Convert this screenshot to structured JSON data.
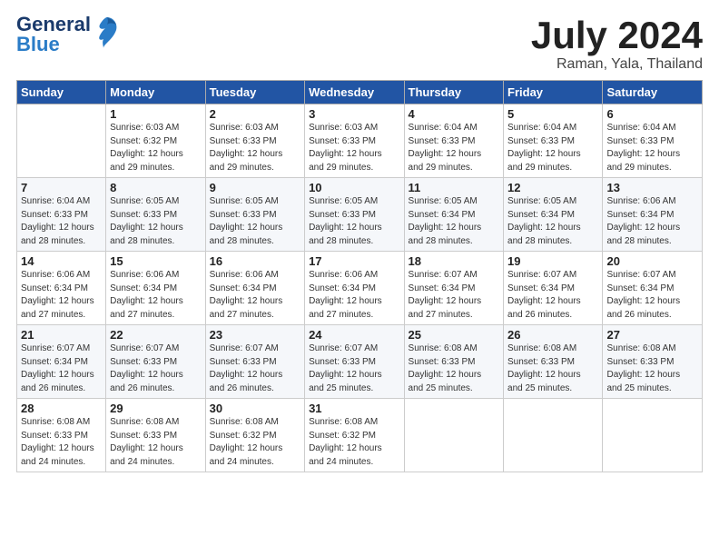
{
  "header": {
    "logo_line1": "General",
    "logo_line2": "Blue",
    "month": "July 2024",
    "location": "Raman, Yala, Thailand"
  },
  "days_of_week": [
    "Sunday",
    "Monday",
    "Tuesday",
    "Wednesday",
    "Thursday",
    "Friday",
    "Saturday"
  ],
  "weeks": [
    [
      {
        "num": "",
        "info": ""
      },
      {
        "num": "1",
        "info": "Sunrise: 6:03 AM\nSunset: 6:32 PM\nDaylight: 12 hours\nand 29 minutes."
      },
      {
        "num": "2",
        "info": "Sunrise: 6:03 AM\nSunset: 6:33 PM\nDaylight: 12 hours\nand 29 minutes."
      },
      {
        "num": "3",
        "info": "Sunrise: 6:03 AM\nSunset: 6:33 PM\nDaylight: 12 hours\nand 29 minutes."
      },
      {
        "num": "4",
        "info": "Sunrise: 6:04 AM\nSunset: 6:33 PM\nDaylight: 12 hours\nand 29 minutes."
      },
      {
        "num": "5",
        "info": "Sunrise: 6:04 AM\nSunset: 6:33 PM\nDaylight: 12 hours\nand 29 minutes."
      },
      {
        "num": "6",
        "info": "Sunrise: 6:04 AM\nSunset: 6:33 PM\nDaylight: 12 hours\nand 29 minutes."
      }
    ],
    [
      {
        "num": "7",
        "info": "Sunrise: 6:04 AM\nSunset: 6:33 PM\nDaylight: 12 hours\nand 28 minutes."
      },
      {
        "num": "8",
        "info": "Sunrise: 6:05 AM\nSunset: 6:33 PM\nDaylight: 12 hours\nand 28 minutes."
      },
      {
        "num": "9",
        "info": "Sunrise: 6:05 AM\nSunset: 6:33 PM\nDaylight: 12 hours\nand 28 minutes."
      },
      {
        "num": "10",
        "info": "Sunrise: 6:05 AM\nSunset: 6:33 PM\nDaylight: 12 hours\nand 28 minutes."
      },
      {
        "num": "11",
        "info": "Sunrise: 6:05 AM\nSunset: 6:34 PM\nDaylight: 12 hours\nand 28 minutes."
      },
      {
        "num": "12",
        "info": "Sunrise: 6:05 AM\nSunset: 6:34 PM\nDaylight: 12 hours\nand 28 minutes."
      },
      {
        "num": "13",
        "info": "Sunrise: 6:06 AM\nSunset: 6:34 PM\nDaylight: 12 hours\nand 28 minutes."
      }
    ],
    [
      {
        "num": "14",
        "info": "Sunrise: 6:06 AM\nSunset: 6:34 PM\nDaylight: 12 hours\nand 27 minutes."
      },
      {
        "num": "15",
        "info": "Sunrise: 6:06 AM\nSunset: 6:34 PM\nDaylight: 12 hours\nand 27 minutes."
      },
      {
        "num": "16",
        "info": "Sunrise: 6:06 AM\nSunset: 6:34 PM\nDaylight: 12 hours\nand 27 minutes."
      },
      {
        "num": "17",
        "info": "Sunrise: 6:06 AM\nSunset: 6:34 PM\nDaylight: 12 hours\nand 27 minutes."
      },
      {
        "num": "18",
        "info": "Sunrise: 6:07 AM\nSunset: 6:34 PM\nDaylight: 12 hours\nand 27 minutes."
      },
      {
        "num": "19",
        "info": "Sunrise: 6:07 AM\nSunset: 6:34 PM\nDaylight: 12 hours\nand 26 minutes."
      },
      {
        "num": "20",
        "info": "Sunrise: 6:07 AM\nSunset: 6:34 PM\nDaylight: 12 hours\nand 26 minutes."
      }
    ],
    [
      {
        "num": "21",
        "info": "Sunrise: 6:07 AM\nSunset: 6:34 PM\nDaylight: 12 hours\nand 26 minutes."
      },
      {
        "num": "22",
        "info": "Sunrise: 6:07 AM\nSunset: 6:33 PM\nDaylight: 12 hours\nand 26 minutes."
      },
      {
        "num": "23",
        "info": "Sunrise: 6:07 AM\nSunset: 6:33 PM\nDaylight: 12 hours\nand 26 minutes."
      },
      {
        "num": "24",
        "info": "Sunrise: 6:07 AM\nSunset: 6:33 PM\nDaylight: 12 hours\nand 25 minutes."
      },
      {
        "num": "25",
        "info": "Sunrise: 6:08 AM\nSunset: 6:33 PM\nDaylight: 12 hours\nand 25 minutes."
      },
      {
        "num": "26",
        "info": "Sunrise: 6:08 AM\nSunset: 6:33 PM\nDaylight: 12 hours\nand 25 minutes."
      },
      {
        "num": "27",
        "info": "Sunrise: 6:08 AM\nSunset: 6:33 PM\nDaylight: 12 hours\nand 25 minutes."
      }
    ],
    [
      {
        "num": "28",
        "info": "Sunrise: 6:08 AM\nSunset: 6:33 PM\nDaylight: 12 hours\nand 24 minutes."
      },
      {
        "num": "29",
        "info": "Sunrise: 6:08 AM\nSunset: 6:33 PM\nDaylight: 12 hours\nand 24 minutes."
      },
      {
        "num": "30",
        "info": "Sunrise: 6:08 AM\nSunset: 6:32 PM\nDaylight: 12 hours\nand 24 minutes."
      },
      {
        "num": "31",
        "info": "Sunrise: 6:08 AM\nSunset: 6:32 PM\nDaylight: 12 hours\nand 24 minutes."
      },
      {
        "num": "",
        "info": ""
      },
      {
        "num": "",
        "info": ""
      },
      {
        "num": "",
        "info": ""
      }
    ]
  ]
}
